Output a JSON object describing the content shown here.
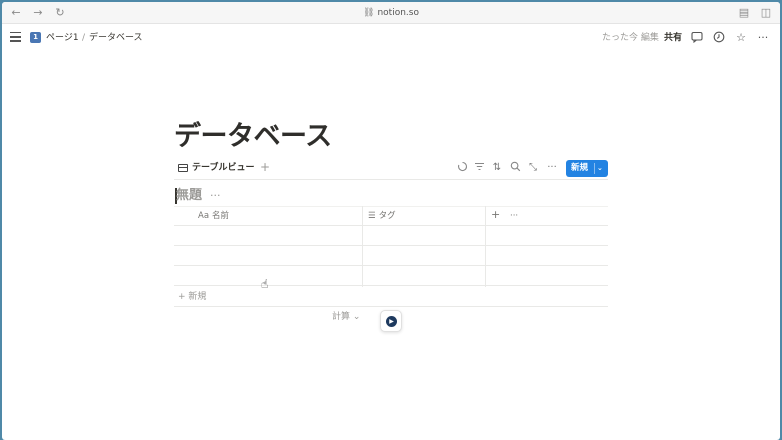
{
  "browser": {
    "url": "notion.so",
    "back_icon": "←",
    "forward_icon": "→",
    "reload_icon": "↻",
    "reader_icon": "▤",
    "sidebar_icon": "◫"
  },
  "topbar": {
    "breadcrumb_page": "ページ1",
    "breadcrumb_sep": "/",
    "breadcrumb_current": "データベース",
    "edited": "たった今 編集",
    "share": "共有"
  },
  "page": {
    "title": "データベース"
  },
  "view": {
    "tab_label": "テーブルビュー",
    "add": "+",
    "new_label": "新規",
    "new_chevron": "⌄"
  },
  "database": {
    "title": "無題",
    "more": "···",
    "columns": [
      {
        "icon": "Aa",
        "label": "名前"
      },
      {
        "icon": "☰",
        "label": "タグ"
      }
    ],
    "add_column": "+",
    "column_more": "···",
    "add_row": "+ 新規",
    "calculate": "計算 ⌄"
  },
  "colors": {
    "accent": "#2383e2",
    "background_frame": "#4f89a8"
  }
}
